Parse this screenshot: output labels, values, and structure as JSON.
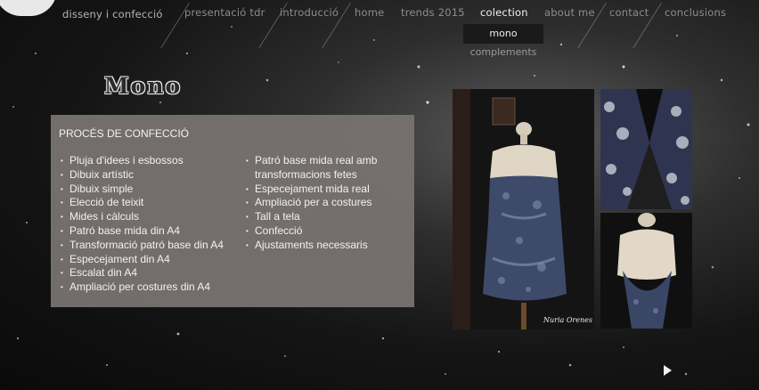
{
  "nav": {
    "items": [
      {
        "label": "disseny i confecció"
      },
      {
        "label": "presentació tdr"
      },
      {
        "label": "introducció"
      },
      {
        "label": "home"
      },
      {
        "label": "trends 2015"
      },
      {
        "label": "colection"
      },
      {
        "label": "about me"
      },
      {
        "label": "contact"
      },
      {
        "label": "conclusions"
      }
    ],
    "submenu": [
      {
        "label": "mono"
      },
      {
        "label": "complements"
      }
    ]
  },
  "page": {
    "title": "Mono"
  },
  "panel": {
    "heading": "PROCÉS DE CONFECCIÓ",
    "column1": [
      "Pluja d'idees i esbossos",
      "Dibuix artístic",
      "Dibuix simple",
      "Elecció de teixit",
      "Mides i càlculs",
      "Patró base mida din A4",
      "Transformació patró base din A4",
      "Especejament din A4",
      "Escalat din A4",
      "Ampliació per costures din A4"
    ],
    "column2": [
      "Patró base mida real amb transformacions fetes",
      "Especejament mida real",
      "Ampliació per a costures",
      "Tall a tela",
      "Confecció",
      "Ajustaments necessaris"
    ]
  },
  "photos": {
    "signature": "Nuria Orenes"
  },
  "colors": {
    "panel_bg": "#78736f",
    "nav_active": "#f2f2f2",
    "nav_text": "#8d8d8d"
  }
}
